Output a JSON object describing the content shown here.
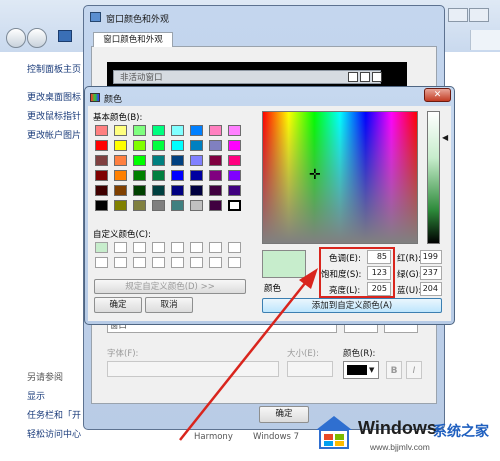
{
  "control_panel": {
    "home_link": "控制面板主页",
    "links": [
      "更改桌面图标",
      "更改鼠标指针",
      "更改帐户图片"
    ],
    "see_also_header": "另请参阅",
    "see_also_links": [
      "显示",
      "任务栏和「开",
      "轻松访问中心"
    ]
  },
  "window_color_dialog": {
    "title": "窗口颜色和外观",
    "tab": "窗口颜色和外观",
    "inactive_window_label": "非活动窗口",
    "item_field_value": "窗口",
    "font_label": "字体(F):",
    "size_label": "大小(E):",
    "color_label": "颜色(R):",
    "bold_label": "B",
    "italic_label": "I",
    "ok_button": "确定",
    "bottom_themes": [
      "Harmony",
      "Windows 7"
    ]
  },
  "color_dialog": {
    "title": "颜色",
    "basic_colors_label": "基本颜色(B):",
    "basic_colors": [
      "#ff8080",
      "#ffff80",
      "#80ff80",
      "#00ff80",
      "#80ffff",
      "#0080ff",
      "#ff80c0",
      "#ff80ff",
      "#ff0000",
      "#ffff00",
      "#80ff00",
      "#00ff40",
      "#00ffff",
      "#0080c0",
      "#8080c0",
      "#ff00ff",
      "#804040",
      "#ff8040",
      "#00ff00",
      "#008080",
      "#004080",
      "#8080ff",
      "#800040",
      "#ff0080",
      "#800000",
      "#ff8000",
      "#008000",
      "#008040",
      "#0000ff",
      "#0000a0",
      "#800080",
      "#8000ff",
      "#400000",
      "#804000",
      "#004000",
      "#004040",
      "#000080",
      "#000040",
      "#400040",
      "#400080",
      "#000000",
      "#808000",
      "#808040",
      "#808080",
      "#408080",
      "#c0c0c0",
      "#400040",
      "#ffffff"
    ],
    "custom_colors_label": "自定义颜色(C):",
    "define_custom_button": "规定自定义颜色(D) >>",
    "ok_button": "确定",
    "cancel_button": "取消",
    "preview_label": "颜色",
    "preview_color": "#c7edcc",
    "hue_label": "色调(E):",
    "hue_value": "85",
    "sat_label": "饱和度(S):",
    "sat_value": "123",
    "lum_label": "亮度(L):",
    "lum_value": "205",
    "red_label": "红(R):",
    "red_value": "199",
    "green_label": "绿(G):",
    "green_value": "237",
    "blue_label": "蓝(U):",
    "blue_value": "204",
    "add_custom_button": "添加到自定义颜色(A)",
    "accent_red": "#d9251d"
  },
  "watermark": {
    "brand": "Windows",
    "cn": "系统之家",
    "url": "www.bjjmlv.com"
  }
}
